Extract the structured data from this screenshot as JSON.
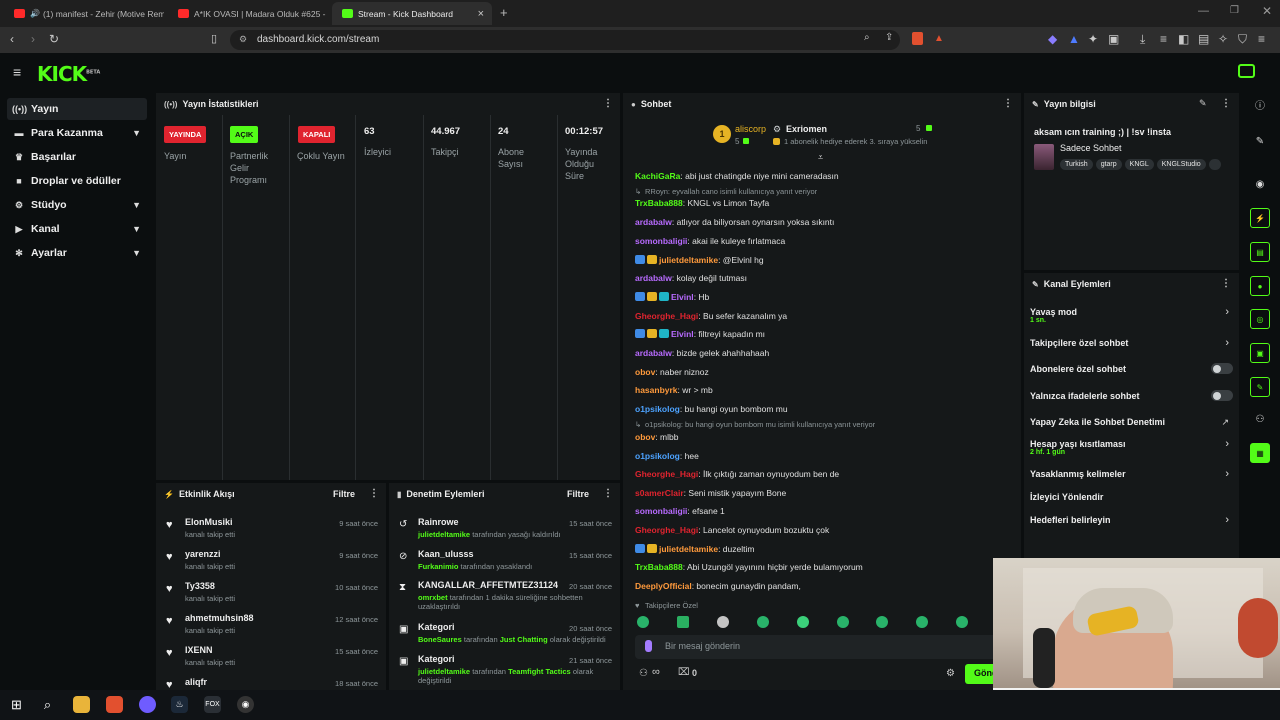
{
  "browser": {
    "tabs": [
      {
        "label": "(1) manifest - Zehir (Motive Remi"
      },
      {
        "label": "A*IK OVASI | Madara Olduk #625 - Y"
      },
      {
        "label": "Stream - Kick Dashboard"
      }
    ],
    "url": "dashboard.kick.com/stream"
  },
  "brand": {
    "logo": "KICK",
    "beta": "BETA",
    "accent": "#53fc18"
  },
  "sidebar": {
    "items": [
      {
        "label": "Yayın",
        "icon": "broadcast-icon"
      },
      {
        "label": "Para Kazanma",
        "icon": "money-icon"
      },
      {
        "label": "Başarılar",
        "icon": "trophy-icon"
      },
      {
        "label": "Droplar ve ödüller",
        "icon": "gift-icon"
      },
      {
        "label": "Stüdyo",
        "icon": "gear-icon"
      },
      {
        "label": "Kanal",
        "icon": "channel-icon"
      },
      {
        "label": "Ayarlar",
        "icon": "settings-icon"
      }
    ]
  },
  "stats": {
    "title": "Yayın İstatistikleri",
    "items": [
      {
        "badge": "YAYINDA",
        "label": "Yayın",
        "color": "#e0242f"
      },
      {
        "badge": "AÇIK",
        "label": "Partnerlik Gelir Programı",
        "color": "#53fc18"
      },
      {
        "badge": "KAPALI",
        "label": "Çoklu Yayın",
        "color": "#e0242f"
      },
      {
        "value": "63",
        "label": "İzleyici"
      },
      {
        "value": "44.967",
        "label": "Takipçi"
      },
      {
        "value": "24",
        "label": "Abone Sayısı"
      },
      {
        "value": "00:12:57",
        "label": "Yayında Olduğu Süre"
      }
    ]
  },
  "activity": {
    "title": "Etkinlik Akışı",
    "filter": "Filtre",
    "rows": [
      {
        "name": "ElonMusiki",
        "sub": "kanalı takip etti",
        "time": "9 saat önce"
      },
      {
        "name": "yarenzzi",
        "sub": "kanalı takip etti",
        "time": "9 saat önce"
      },
      {
        "name": "Ty3358",
        "sub": "kanalı takip etti",
        "time": "10 saat önce"
      },
      {
        "name": "ahmetmuhsin88",
        "sub": "kanalı takip etti",
        "time": "12 saat önce"
      },
      {
        "name": "IXENN",
        "sub": "kanalı takip etti",
        "time": "15 saat önce"
      },
      {
        "name": "aliqfr",
        "sub": "",
        "time": "18 saat önce"
      }
    ]
  },
  "moderation": {
    "title": "Denetim Eylemleri",
    "filter": "Filtre",
    "rows": [
      {
        "name": "Rainrowe",
        "actor": "julietdeltamike",
        "rest": "tarafından yasağı kaldırıldı",
        "time": "15 saat önce"
      },
      {
        "name": "Kaan_ulusss",
        "actor": "Furkanimio",
        "rest": "tarafından yasaklandı",
        "time": "15 saat önce"
      },
      {
        "name": "KANGALLAR_AFFETMTEZ31124",
        "actor": "omrxbet",
        "rest": "tarafından 1 dakika süreliğine sohbetten uzaklaştırıldı",
        "time": "20 saat önce"
      },
      {
        "name": "Kategori",
        "actor": "BoneSaures",
        "rest": "tarafından",
        "cat": "Just Chatting",
        "rest2": "olarak değiştirildi",
        "time": "20 saat önce"
      },
      {
        "name": "Kategori",
        "actor": "julietdeltamike",
        "rest": "tarafından",
        "cat": "Teamfight Tactics",
        "rest2": "olarak değiştirildi",
        "time": "21 saat önce"
      }
    ]
  },
  "chat": {
    "title": "Sohbet",
    "pinned": {
      "rank": "1",
      "user": "aliscorp",
      "count_left": "5",
      "gifter": "Exriomen",
      "count_right": "5",
      "text": "1 abonelik hediye ederek 3. sıraya yükselin"
    },
    "messages": [
      {
        "user": "KachiGaRa",
        "color": "#53fc18",
        "text": "abi just chatingde niye mini cameradasın"
      },
      {
        "reply": "RRoyn: eyvallah cano isimli kullanıcıya yanıt veriyor"
      },
      {
        "user": "TrxBaba888",
        "color": "#53fc18",
        "text": "KNGL vs Limon Tayfa"
      },
      {
        "user": "ardabalw",
        "color": "#b86bff",
        "text": "atlıyor da biliyorsan oynarsın yoksa sıkıntı"
      },
      {
        "user": "somonbaligii",
        "color": "#b86bff",
        "text": "akai ile kuleye fırlatmaca"
      },
      {
        "user": "julietdeltamike",
        "color": "#ff9a3c",
        "text": "@Elvinl hg",
        "badges": 2
      },
      {
        "user": "ardabalw",
        "color": "#b86bff",
        "text": "kolay değil tutması"
      },
      {
        "user": "Elvinl",
        "color": "#b86bff",
        "text": "Hb",
        "badges": 3
      },
      {
        "user": "Gheorghe_Hagi",
        "color": "#e0242f",
        "text": "Bu sefer kazanalım ya"
      },
      {
        "user": "Elvinl",
        "color": "#b86bff",
        "text": "filtreyi kapadın mı",
        "badges": 3
      },
      {
        "user": "ardabalw",
        "color": "#b86bff",
        "text": "bizde gelek ahahhahaah"
      },
      {
        "user": "obov",
        "color": "#ff9a3c",
        "text": "naber niznoz"
      },
      {
        "user": "hasanbyrk",
        "color": "#ff9a3c",
        "text": "wr > mb"
      },
      {
        "user": "o1psikolog",
        "color": "#4da3ff",
        "text": "bu hangi oyun bombom mu"
      },
      {
        "reply": "o1psikolog: bu hangi oyun bombom mu isimli kullanıcıya yanıt veriyor"
      },
      {
        "user": "obov",
        "color": "#ff9a3c",
        "text": "mlbb"
      },
      {
        "user": "o1psikolog",
        "color": "#4da3ff",
        "text": "hee"
      },
      {
        "user": "Gheorghe_Hagi",
        "color": "#e0242f",
        "text": "İlk çıktığı zaman oynuyodum ben de"
      },
      {
        "user": "s0amerClair",
        "color": "#e0242f",
        "text": "Seni mistik yapayım Bone"
      },
      {
        "user": "somonbaligii",
        "color": "#b86bff",
        "text": "efsane 1"
      },
      {
        "user": "Gheorghe_Hagi",
        "color": "#e0242f",
        "text": "Lancelot oynuyodum bozuktu çok"
      },
      {
        "user": "julietdeltamike",
        "color": "#ff9a3c",
        "text": "duzeltim",
        "badges": 2
      },
      {
        "user": "TrxBaba888",
        "color": "#53fc18",
        "text": "Abi Uzungöl yayınını hiçbir yerde bulamıyorum"
      },
      {
        "user": "DeeplyOfficial",
        "color": "#ff9a3c",
        "text": "bonecim gunaydin pandam,"
      }
    ],
    "followers_only": "Takipçilere Özel",
    "input_placeholder": "Bir mesaj gönderin",
    "send": "Gönd",
    "count_a": "∞",
    "count_b": "0"
  },
  "stream_info": {
    "title": "Yayın bilgisi",
    "stream_title": "aksam ıcın training ;) | !sv !insta",
    "category": "Sadece Sohbet",
    "tags": [
      "Turkish",
      "gtarp",
      "KNGL",
      "KNGLStudio"
    ]
  },
  "channel_actions": {
    "title": "Kanal Eylemleri",
    "rows": [
      {
        "label": "Yavaş mod",
        "sub": "1 sn.",
        "control": "chevron"
      },
      {
        "label": "Takipçilere özel sohbet",
        "control": "chevron"
      },
      {
        "label": "Abonelere özel sohbet",
        "control": "toggle"
      },
      {
        "label": "Yalnızca ifadelerle sohbet",
        "control": "toggle"
      },
      {
        "label": "Yapay Zeka ile Sohbet Denetimi",
        "control": "external"
      },
      {
        "label": "Hesap yaşı kısıtlaması",
        "sub": "2 hf. 1 gün",
        "control": "chevron"
      },
      {
        "label": "Yasaklanmış kelimeler",
        "control": "chevron"
      },
      {
        "label": "İzleyici Yönlendir",
        "control": "none"
      },
      {
        "label": "Hedefleri belirleyin",
        "control": "chevron"
      }
    ]
  }
}
